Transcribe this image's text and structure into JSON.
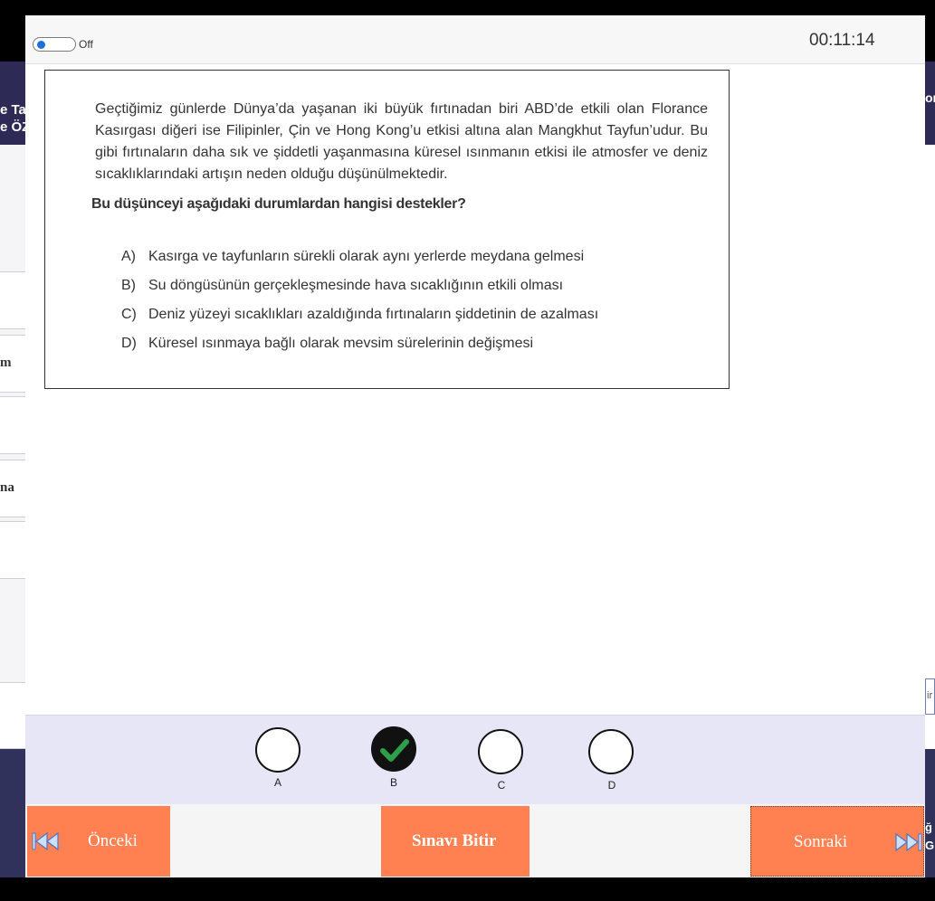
{
  "background": {
    "left_top_lines": [
      "e Tas",
      "e ÖZ"
    ],
    "left_labels": [
      "m",
      "na"
    ],
    "right_top": "on",
    "right_mid": "ir",
    "right_bottom_lines": [
      "ğ",
      "G"
    ]
  },
  "topbar": {
    "toggle_label": "Off",
    "timer": "00:11:14"
  },
  "question": {
    "passage": "Geçtiğimiz günlerde Dünya’da yaşanan iki büyük fırtınadan biri ABD’de etkili olan Florance Kasırgası diğeri ise Filipinler, Çin ve Hong Kong’u etkisi altına alan Mangkhut Tayfun’udur. Bu gibi fırtınaların daha sık ve şiddetli yaşanmasına küresel ısınmanın etkisi ile atmosfer ve deniz sıcaklıklarındaki artışın neden olduğu düşünülmektedir.",
    "prompt": "Bu düşünceyi aşağıdaki durumlardan hangisi destekler?",
    "choices": [
      {
        "letter": "A)",
        "text": "Kasırga ve tayfunların sürekli olarak aynı yerlerde meydana gelmesi"
      },
      {
        "letter": "B)",
        "text": "Su döngüsünün gerçekleşmesinde hava sıcaklığının etkili olması"
      },
      {
        "letter": "C)",
        "text": "Deniz yüzeyi sıcaklıkları azaldığında fırtınaların şiddetinin de azalması"
      },
      {
        "letter": "D)",
        "text": "Küresel ısınmaya bağlı olarak mevsim sürelerinin değişmesi"
      }
    ]
  },
  "answers": {
    "options": [
      "A",
      "B",
      "C",
      "D"
    ],
    "selected": "B",
    "check_color": "#2e9e4a"
  },
  "nav": {
    "prev_label": "Önceki",
    "finish_label": "Sınavı Bitir",
    "next_label": "Sonraki",
    "accent": "#ff8050"
  }
}
